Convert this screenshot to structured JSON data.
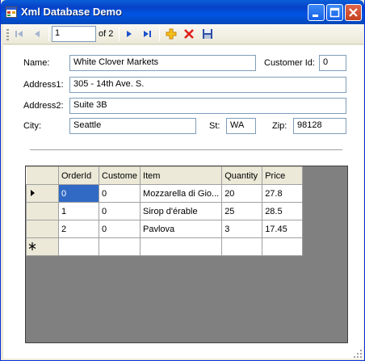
{
  "window": {
    "title": "Xml Database Demo"
  },
  "navigator": {
    "position": "1",
    "count_label": "of 2"
  },
  "form": {
    "name_label": "Name:",
    "name_value": "White Clover Markets",
    "customer_id_label": "Customer Id:",
    "customer_id_value": "0",
    "address1_label": "Address1:",
    "address1_value": "305 - 14th Ave. S.",
    "address2_label": "Address2:",
    "address2_value": "Suite 3B",
    "city_label": "City:",
    "city_value": "Seattle",
    "state_label": "St:",
    "state_value": "WA",
    "zip_label": "Zip:",
    "zip_value": "98128"
  },
  "orders": {
    "columns": [
      "OrderId",
      "Custome",
      "Item",
      "Quantity",
      "Price"
    ],
    "rows": [
      [
        "0",
        "0",
        "Mozzarella di Gio...",
        "20",
        "27.8"
      ],
      [
        "1",
        "0",
        "Sirop d'érable",
        "25",
        "28.5"
      ],
      [
        "2",
        "0",
        "Pavlova",
        "3",
        "17.45"
      ]
    ]
  },
  "colors": {
    "titlebar": "#0054e3",
    "selection": "#316ac5",
    "grid_background": "#808080"
  },
  "icons": [
    "app-icon",
    "minimize-icon",
    "maximize-icon",
    "close-icon",
    "move-first-icon",
    "move-previous-icon",
    "move-next-icon",
    "move-last-icon",
    "add-new-icon",
    "delete-icon",
    "save-icon",
    "current-row-icon",
    "new-row-icon"
  ]
}
